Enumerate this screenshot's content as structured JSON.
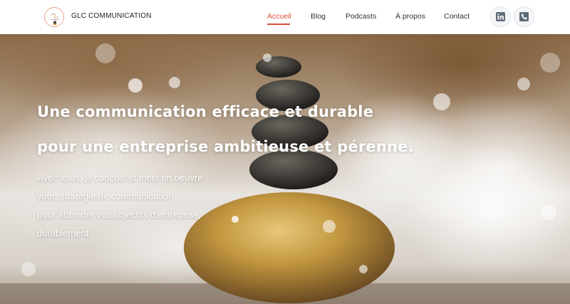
{
  "header": {
    "brand_name": "GLC COMMUNICATION",
    "nav": [
      {
        "label": "Accueil",
        "active": true
      },
      {
        "label": "Blog",
        "active": false
      },
      {
        "label": "Podcasts",
        "active": false
      },
      {
        "label": "À propos",
        "active": false
      },
      {
        "label": "Contact",
        "active": false
      }
    ],
    "social": [
      {
        "icon": "linkedin-icon"
      },
      {
        "icon": "phone-icon"
      }
    ],
    "accent_color": "#d9513f"
  },
  "hero": {
    "title_line1": "Une communication efficace et durable",
    "title_line2": "pour une entreprise ambitieuse et pérenne.",
    "body_lines": [
      "Avec vous, je conçois et mets en oeuvre",
      "votre stratégie de communication",
      "pour atteindre vos objectifs d'entreprise,",
      "durablement."
    ]
  }
}
